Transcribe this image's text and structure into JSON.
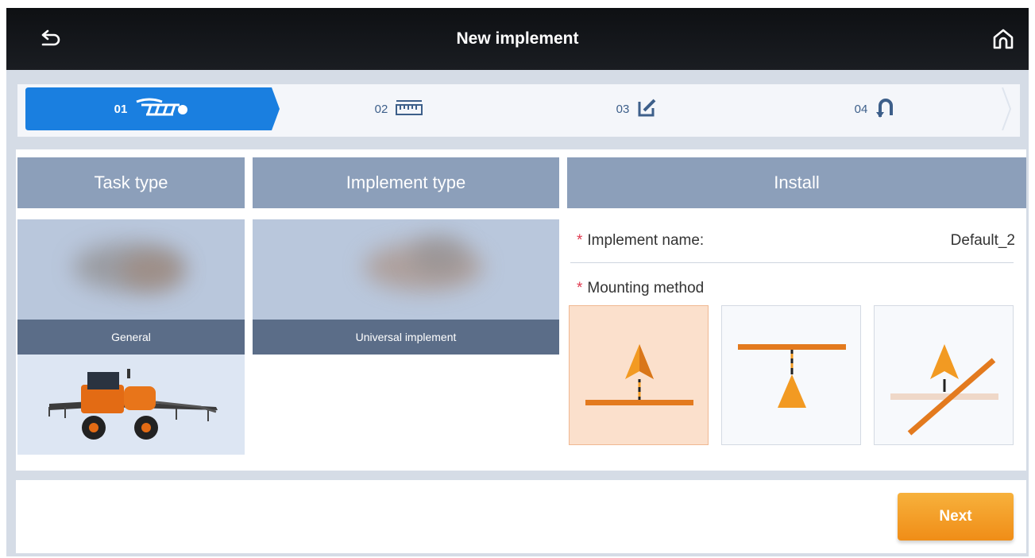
{
  "header": {
    "title": "New implement",
    "back_icon": "back-arrow-icon",
    "home_icon": "home-icon"
  },
  "stepper": {
    "steps": [
      {
        "number": "01",
        "icon": "plough-icon",
        "active": true
      },
      {
        "number": "02",
        "icon": "ruler-icon",
        "active": false
      },
      {
        "number": "03",
        "icon": "edit-icon",
        "active": false
      },
      {
        "number": "04",
        "icon": "u-turn-icon",
        "active": false
      }
    ],
    "active_color": "#1a7fe0"
  },
  "columns": {
    "task_type": {
      "header": "Task type",
      "items": [
        {
          "label": "General",
          "selected": true
        },
        {
          "label": "",
          "image": "sprayer-tractor-image"
        }
      ]
    },
    "implement_type": {
      "header": "Implement type",
      "items": [
        {
          "label": "Universal implement",
          "selected": true
        }
      ]
    },
    "install": {
      "header": "Install",
      "required_mark": "*",
      "implement_name_label": "Implement name:",
      "implement_name_value": "Default_2",
      "mounting_method_label": "Mounting method",
      "mounting_options": [
        {
          "name": "rear-mounted",
          "selected": true
        },
        {
          "name": "front-mounted",
          "selected": false
        },
        {
          "name": "offset-mounted",
          "selected": false
        }
      ]
    }
  },
  "footer": {
    "next_label": "Next"
  },
  "colors": {
    "header_bg": "#121418",
    "column_header_bg": "#8c9fba",
    "tile_label_bg": "#5b6d88",
    "accent_orange": "#f29a22",
    "selected_mount_bg": "#fbe0cc"
  }
}
